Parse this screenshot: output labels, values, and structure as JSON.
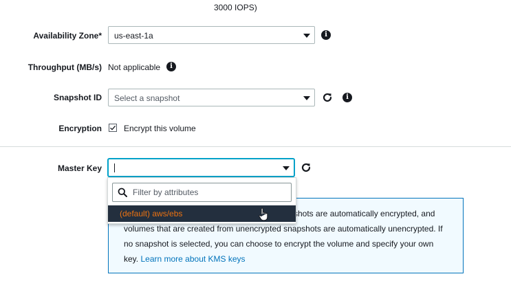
{
  "top": {
    "iops_text": "3000 IOPS)"
  },
  "availability_zone": {
    "label": "Availability Zone*",
    "value": "us-east-1a"
  },
  "throughput": {
    "label": "Throughput (MB/s)",
    "value": "Not applicable"
  },
  "snapshot": {
    "label": "Snapshot ID",
    "placeholder": "Select a snapshot"
  },
  "encryption": {
    "label": "Encryption",
    "checkbox_label": "Encrypt this volume",
    "checked": true
  },
  "master_key": {
    "label": "Master Key",
    "value": "",
    "filter_placeholder": "Filter by attributes",
    "options": [
      "(default) aws/ebs"
    ]
  },
  "info": {
    "line1": "shots are automatically encrypted, and",
    "line2": "volumes that are created from unencrypted snapshots are automatically unencrypted. If",
    "line3": "no snapshot is selected, you can choose to encrypt the volume and specify your own",
    "line4_prefix": "key.",
    "link": "Learn more about KMS keys"
  },
  "icons": [
    "info-icon",
    "chevron-down-icon",
    "refresh-icon",
    "checkbox-icon",
    "search-icon",
    "hand-pointer-icon"
  ],
  "colors": {
    "accent_orange": "#ec7211",
    "link_blue": "#0073bb",
    "option_dark": "#232f3e",
    "info_bg": "#f1faff"
  }
}
